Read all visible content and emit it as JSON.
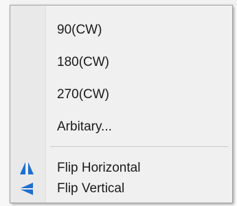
{
  "menu": {
    "items": [
      {
        "label": "90(CW)"
      },
      {
        "label": "180(CW)"
      },
      {
        "label": "270(CW)"
      },
      {
        "label": "Arbitary..."
      }
    ],
    "flip_items": [
      {
        "label": "Flip Horizontal",
        "icon": "flip-horizontal-icon"
      },
      {
        "label": "Flip Vertical",
        "icon": "flip-vertical-icon"
      }
    ]
  },
  "colors": {
    "icon_blue": "#1e6fd0",
    "menu_bg": "#f0f0f0",
    "gutter_bg": "#e9e9e9",
    "text": "#1a1a1a"
  }
}
